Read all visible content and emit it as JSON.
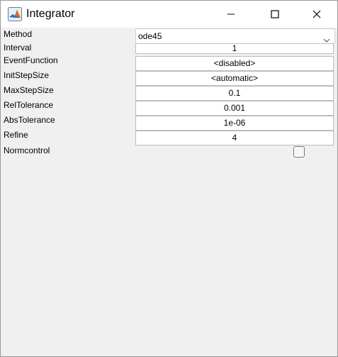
{
  "window": {
    "title": "Integrator"
  },
  "titlebar_buttons": {
    "minimize_icon": "minimize-icon",
    "maximize_icon": "maximize-icon",
    "close_icon": "close-icon"
  },
  "properties": {
    "method": {
      "label": "Method",
      "value": "ode45"
    },
    "interval": {
      "label": "Interval",
      "value": "1"
    },
    "event_function": {
      "label": "EventFunction",
      "value": "<disabled>"
    },
    "init_step_size": {
      "label": "InitStepSize",
      "value": "<automatic>"
    },
    "max_step_size": {
      "label": "MaxStepSize",
      "value": "0.1"
    },
    "rel_tolerance": {
      "label": "RelTolerance",
      "value": "0.001"
    },
    "abs_tolerance": {
      "label": "AbsTolerance",
      "value": "1e-06"
    },
    "refine": {
      "label": "Refine",
      "value": "4"
    },
    "normcontrol": {
      "label": "Normcontrol",
      "checked": false
    }
  },
  "colors": {
    "panel_background": "#f0f0f0",
    "titlebar_background": "#ffffff",
    "field_border": "#bdbdbd"
  }
}
